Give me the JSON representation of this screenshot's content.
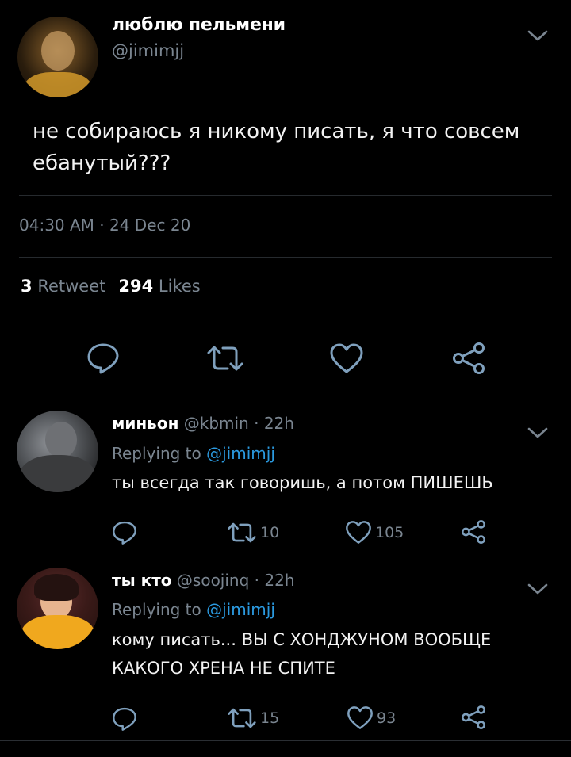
{
  "main_tweet": {
    "name": "люблю пельмени",
    "handle": "@jimimjj",
    "text": "не собираюсь я никому писать, я что совсем ебанутый???",
    "timestamp": "04:30 AM · 24 Dec 20",
    "retweet_count": "3",
    "retweet_label": "Retweet",
    "likes_count": "294",
    "likes_label": "Likes"
  },
  "replies": [
    {
      "name": "миньон",
      "handle": "@kbmin",
      "time": "· 22h",
      "replying_prefix": "Replying to",
      "replying_handle": "@jimimjj",
      "text": "ты всегда так говоришь, а потом ПИШЕШЬ",
      "retweets": "10",
      "likes": "105"
    },
    {
      "name": "ты кто",
      "handle": "@soojinq",
      "time": "· 22h",
      "replying_prefix": "Replying to",
      "replying_handle": "@jimimjj",
      "text": "кому писать... ВЫ С ХОНДЖУНОМ ВООБЩЕ КАКОГО ХРЕНА НЕ СПИТЕ",
      "retweets": "15",
      "likes": "93"
    }
  ],
  "colors": {
    "background": "#000000",
    "muted": "#7a8590",
    "link": "#2b9ae0",
    "icon": "#7fa0bd"
  }
}
